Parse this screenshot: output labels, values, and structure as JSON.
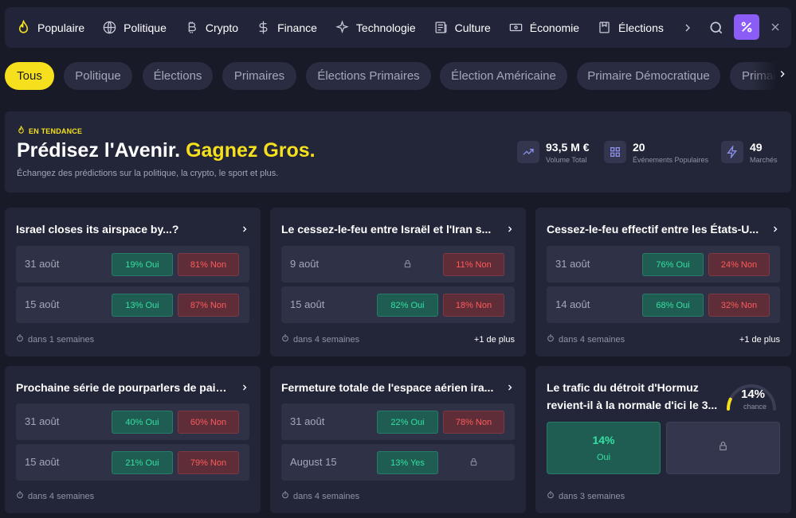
{
  "nav": {
    "items": [
      {
        "label": "Populaire",
        "icon": "flame-icon"
      },
      {
        "label": "Politique",
        "icon": "globe-icon"
      },
      {
        "label": "Crypto",
        "icon": "bitcoin-icon"
      },
      {
        "label": "Finance",
        "icon": "dollar-icon"
      },
      {
        "label": "Technologie",
        "icon": "sparkle-icon"
      },
      {
        "label": "Culture",
        "icon": "newspaper-icon"
      },
      {
        "label": "Économie",
        "icon": "banknote-icon"
      },
      {
        "label": "Élections",
        "icon": "ballot-icon"
      }
    ],
    "accent": "#8b5cf6"
  },
  "chips": [
    "Tous",
    "Politique",
    "Élections",
    "Primaires",
    "Élections Primaires",
    "Élection Américaine",
    "Primaire Démocratique",
    "Primaire"
  ],
  "hero": {
    "badge": "EN TENDANCE",
    "title": "Prédisez l'Avenir.",
    "title_highlight": "Gagnez Gros.",
    "subtitle": "Échangez des prédictions sur la politique, la crypto, le sport et plus.",
    "stats": [
      {
        "value": "93,5 M €",
        "caption": "Volume Total",
        "icon": "trending-up-icon"
      },
      {
        "value": "20",
        "caption": "Événements Populaires",
        "icon": "grid-icon"
      },
      {
        "value": "49",
        "caption": "Marchés",
        "icon": "bolt-icon"
      }
    ]
  },
  "cards": [
    {
      "title": "Israel closes its airspace by...?",
      "rows": [
        {
          "date": "31 août",
          "yes": "19% Oui",
          "no": "81% Non"
        },
        {
          "date": "15 août",
          "yes": "13% Oui",
          "no": "87% Non"
        }
      ],
      "footer": "dans 1 semaines",
      "more": ""
    },
    {
      "title": "Le cessez-le-feu entre Israël et l'Iran s...",
      "rows": [
        {
          "date": "9 août",
          "yes": "",
          "no": "11% Non"
        },
        {
          "date": "15 août",
          "yes": "82% Oui",
          "no": "18% Non"
        }
      ],
      "footer": "dans 4 semaines",
      "more": "+1 de plus"
    },
    {
      "title": "Cessez-le-feu effectif entre les États-U...",
      "rows": [
        {
          "date": "31 août",
          "yes": "76% Oui",
          "no": "24% Non"
        },
        {
          "date": "14 août",
          "yes": "68% Oui",
          "no": "32% Non"
        }
      ],
      "footer": "dans 4 semaines",
      "more": "+1 de plus"
    },
    {
      "title": "Prochaine série de pourparlers de paix ...",
      "rows": [
        {
          "date": "31 août",
          "yes": "40% Oui",
          "no": "60% Non"
        },
        {
          "date": "15 août",
          "yes": "21% Oui",
          "no": "79% Non"
        }
      ],
      "footer": "dans 4 semaines",
      "more": ""
    },
    {
      "title": "Fermeture totale de l'espace aérien ira...",
      "rows": [
        {
          "date": "31 août",
          "yes": "22% Oui",
          "no": "78% Non"
        },
        {
          "date": "August 15",
          "yes": "13% Yes",
          "no": ""
        }
      ],
      "footer": "dans 4 semaines",
      "more": ""
    }
  ],
  "special_card": {
    "title_line1": "Le trafic du détroit d'Hormuz",
    "title_line2": "revient-il à la normale d'ici le 3...",
    "chance_pct": "14%",
    "chance_label": "chance",
    "chance_value": 0.14,
    "yes_pct": "14%",
    "yes_label": "Oui",
    "footer": "dans 3 semaines"
  },
  "colors": {
    "yellow": "#f6e01e",
    "green": "#34e0a1",
    "red": "#ff5b5b",
    "background": "#181a27"
  }
}
